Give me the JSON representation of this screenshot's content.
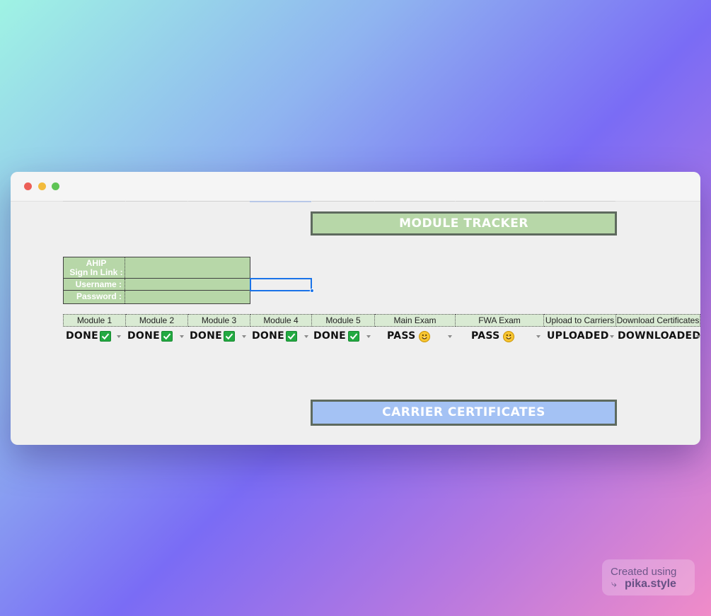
{
  "sheet": {
    "module_banner": "MODULE TRACKER",
    "carrier_banner": "CARRIER CERTIFICATES"
  },
  "login": {
    "ahip_label_line1": "AHIP",
    "ahip_label_line2": "Sign In Link :",
    "username_label": "Username :",
    "password_label": "Password :",
    "ahip_value": "",
    "username_value": "",
    "password_value": ""
  },
  "tracker": {
    "headers": [
      "Module 1",
      "Module 2",
      "Module 3",
      "Module 4",
      "Module 5",
      "Main Exam",
      "FWA Exam",
      "Upload to Carriers",
      "Download Certificates"
    ],
    "values": [
      {
        "text": "DONE",
        "icon": "checkmark-icon"
      },
      {
        "text": "DONE",
        "icon": "checkmark-icon"
      },
      {
        "text": "DONE",
        "icon": "checkmark-icon"
      },
      {
        "text": "DONE",
        "icon": "checkmark-icon"
      },
      {
        "text": "DONE",
        "icon": "checkmark-icon"
      },
      {
        "text": "PASS",
        "icon": "smiley-icon"
      },
      {
        "text": "PASS",
        "icon": "smiley-icon"
      },
      {
        "text": "UPLOADED",
        "icon": ""
      },
      {
        "text": "DOWNLOADED",
        "icon": ""
      }
    ]
  },
  "watermark": {
    "line1": "Created using",
    "arrow": "⤷",
    "line2": "pika.style"
  },
  "colors": {
    "green_fill": "#b7d7a8",
    "light_green_header": "#d9ead3",
    "blue_banner": "#a4c2f4",
    "selection_blue": "#1a73e8",
    "check_green": "#23a942"
  }
}
